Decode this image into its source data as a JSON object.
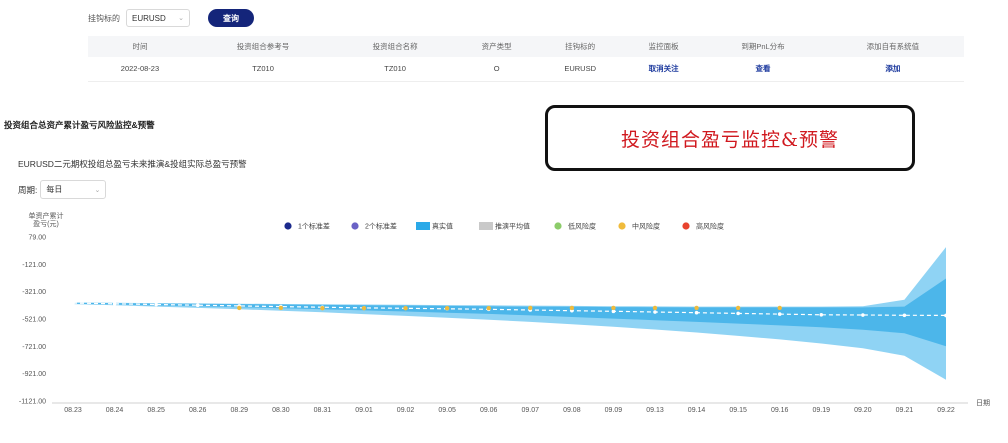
{
  "filter": {
    "label": "挂钩标的",
    "value": "EURUSD",
    "query_label": "查询"
  },
  "table": {
    "headers": [
      "时间",
      "投资组合参考号",
      "投资组合名称",
      "资产类型",
      "挂钩标的",
      "监控面板",
      "到期PnL分布",
      "添加自有系统值"
    ],
    "rows": [
      [
        "2022-08-23",
        "TZ010",
        "TZ010",
        "O",
        "EURUSD",
        "取消关注",
        "查看",
        "添加"
      ]
    ]
  },
  "section_title": "投资组合总资产累计盈亏风险监控&预警",
  "callout": "投资组合盈亏监控&预警",
  "chart_title": "EURUSD二元期权投组总盈亏未来推演&投组实际总盈亏预警",
  "period": {
    "label": "周期:",
    "value": "每日"
  },
  "colors": {
    "sigma1": "#1b2a8c",
    "sigma2": "#6a62c6",
    "actual": "#2aa9e8",
    "mean": "#c9c9c9",
    "low": "#8ccc6a",
    "mid": "#f0bb3c",
    "high": "#e8432e",
    "band_outer": "#8fd3f4",
    "band_inner": "#4cb6ea"
  },
  "chart_data": {
    "type": "area",
    "ylabel_lines": [
      "单资产累计",
      "盈亏(元)"
    ],
    "xlabel": "日期",
    "ylim": [
      -1121,
      79
    ],
    "yticks": [
      "79.00",
      "-121.00",
      "-321.00",
      "-521.00",
      "-721.00",
      "-921.00",
      "-1121.00"
    ],
    "ytick_values": [
      79,
      -121,
      -321,
      -521,
      -721,
      -921,
      -1121
    ],
    "categories": [
      "08.23",
      "08.24",
      "08.25",
      "08.26",
      "08.29",
      "08.30",
      "08.31",
      "09.01",
      "09.02",
      "09.05",
      "09.06",
      "09.07",
      "09.08",
      "09.09",
      "09.13",
      "09.14",
      "09.15",
      "09.16",
      "09.19",
      "09.20",
      "09.21",
      "09.22"
    ],
    "legend": [
      {
        "name": "1个标准差",
        "kind": "dot",
        "color": "#1b2a8c"
      },
      {
        "name": "2个标准差",
        "kind": "dot",
        "color": "#6a62c6"
      },
      {
        "name": "真实值",
        "kind": "rect",
        "color": "#2aa9e8"
      },
      {
        "name": "推演平均值",
        "kind": "rect",
        "color": "#c9c9c9"
      },
      {
        "name": "低风险度",
        "kind": "dot",
        "color": "#8ccc6a"
      },
      {
        "name": "中风险度",
        "kind": "dot",
        "color": "#f0bb3c"
      },
      {
        "name": "高风险度",
        "kind": "dot",
        "color": "#e8432e"
      }
    ],
    "series": [
      {
        "name": "推演平均值",
        "values": [
          -405,
          -410,
          -415,
          -420,
          -425,
          -430,
          -435,
          -440,
          -443,
          -446,
          -450,
          -455,
          -460,
          -465,
          -470,
          -475,
          -480,
          -485,
          -490,
          -492,
          -494,
          -495
        ]
      },
      {
        "name": "1个标准差",
        "upper": [
          -402,
          -405,
          -408,
          -410,
          -412,
          -415,
          -418,
          -420,
          -422,
          -425,
          -428,
          -430,
          -432,
          -434,
          -435,
          -436,
          -436,
          -436,
          -436,
          -436,
          -430,
          -225
        ],
        "lower": [
          -410,
          -415,
          -422,
          -428,
          -435,
          -442,
          -450,
          -458,
          -466,
          -475,
          -484,
          -495,
          -506,
          -518,
          -530,
          -542,
          -555,
          -568,
          -582,
          -600,
          -625,
          -720
        ]
      },
      {
        "name": "2个标准差",
        "upper": [
          -400,
          -402,
          -405,
          -407,
          -409,
          -411,
          -413,
          -415,
          -417,
          -419,
          -421,
          -423,
          -425,
          -427,
          -429,
          -430,
          -430,
          -430,
          -430,
          -428,
          -380,
          5
        ],
        "lower": [
          -412,
          -420,
          -430,
          -440,
          -450,
          -460,
          -472,
          -485,
          -498,
          -512,
          -526,
          -542,
          -560,
          -578,
          -598,
          -620,
          -645,
          -670,
          -700,
          -735,
          -790,
          -965
        ]
      },
      {
        "name": "中风险度",
        "values": [
          null,
          null,
          null,
          null,
          -440,
          -440,
          -442,
          -442,
          -442,
          -442,
          -442,
          -440,
          -440,
          -440,
          -440,
          -440,
          -440,
          -440,
          null,
          null,
          null,
          null
        ]
      }
    ]
  }
}
